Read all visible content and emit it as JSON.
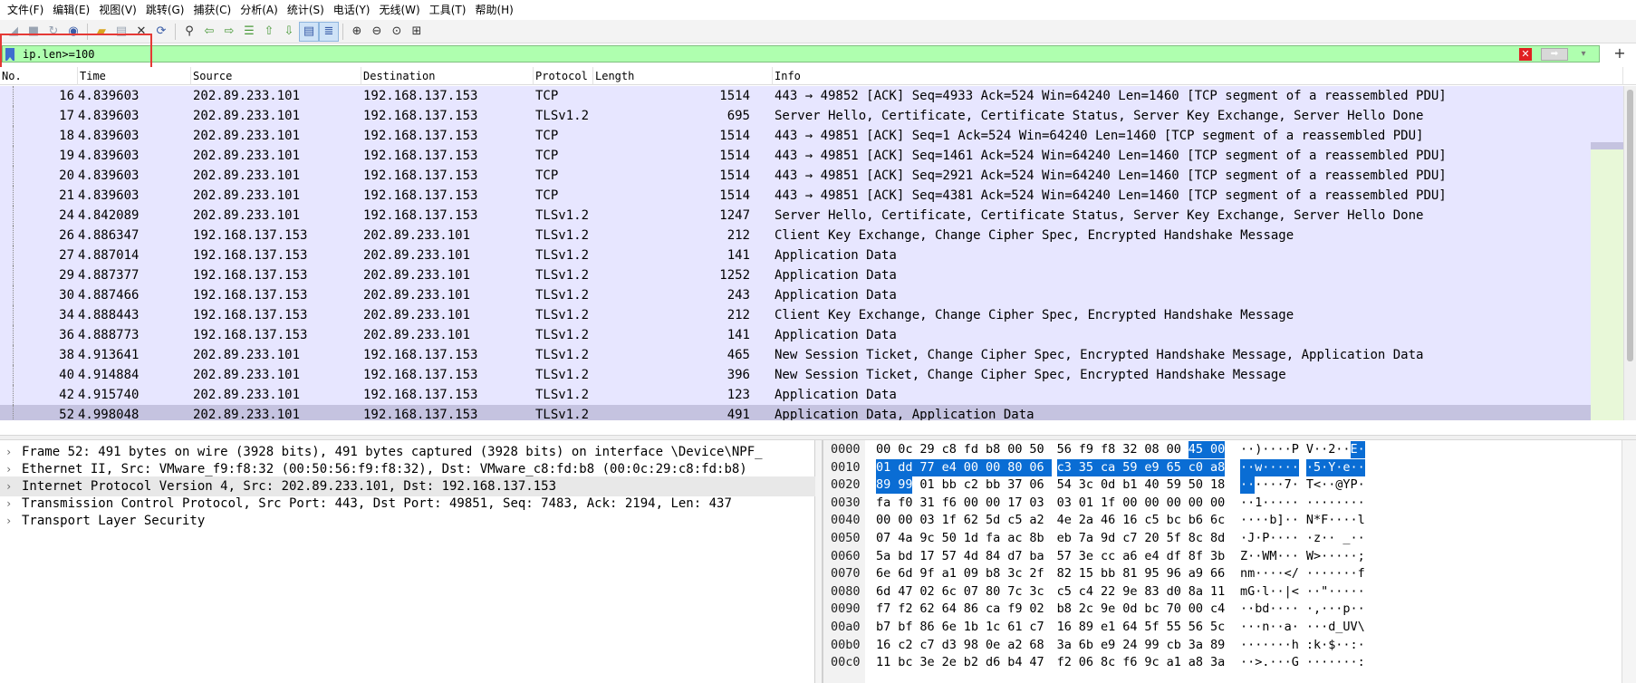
{
  "menu": [
    "文件(F)",
    "编辑(E)",
    "视图(V)",
    "跳转(G)",
    "捕获(C)",
    "分析(A)",
    "统计(S)",
    "电话(Y)",
    "无线(W)",
    "工具(T)",
    "帮助(H)"
  ],
  "filter": {
    "value": "ip.len>=100",
    "clear_label": "✕",
    "apply_label": "➡",
    "add_label": "+"
  },
  "columns": [
    "No.",
    "Time",
    "Source",
    "Destination",
    "Protocol",
    "Length",
    "Info"
  ],
  "packets": [
    {
      "no": "16",
      "time": "4.839603",
      "src": "202.89.233.101",
      "dst": "192.168.137.153",
      "proto": "TCP",
      "len": "1514",
      "info": "443 → 49852 [ACK] Seq=4933 Ack=524 Win=64240 Len=1460 [TCP segment of a reassembled PDU]"
    },
    {
      "no": "17",
      "time": "4.839603",
      "src": "202.89.233.101",
      "dst": "192.168.137.153",
      "proto": "TLSv1.2",
      "len": "695",
      "info": "Server Hello, Certificate, Certificate Status, Server Key Exchange, Server Hello Done"
    },
    {
      "no": "18",
      "time": "4.839603",
      "src": "202.89.233.101",
      "dst": "192.168.137.153",
      "proto": "TCP",
      "len": "1514",
      "info": "443 → 49851 [ACK] Seq=1 Ack=524 Win=64240 Len=1460 [TCP segment of a reassembled PDU]"
    },
    {
      "no": "19",
      "time": "4.839603",
      "src": "202.89.233.101",
      "dst": "192.168.137.153",
      "proto": "TCP",
      "len": "1514",
      "info": "443 → 49851 [ACK] Seq=1461 Ack=524 Win=64240 Len=1460 [TCP segment of a reassembled PDU]"
    },
    {
      "no": "20",
      "time": "4.839603",
      "src": "202.89.233.101",
      "dst": "192.168.137.153",
      "proto": "TCP",
      "len": "1514",
      "info": "443 → 49851 [ACK] Seq=2921 Ack=524 Win=64240 Len=1460 [TCP segment of a reassembled PDU]"
    },
    {
      "no": "21",
      "time": "4.839603",
      "src": "202.89.233.101",
      "dst": "192.168.137.153",
      "proto": "TCP",
      "len": "1514",
      "info": "443 → 49851 [ACK] Seq=4381 Ack=524 Win=64240 Len=1460 [TCP segment of a reassembled PDU]"
    },
    {
      "no": "24",
      "time": "4.842089",
      "src": "202.89.233.101",
      "dst": "192.168.137.153",
      "proto": "TLSv1.2",
      "len": "1247",
      "info": "Server Hello, Certificate, Certificate Status, Server Key Exchange, Server Hello Done"
    },
    {
      "no": "26",
      "time": "4.886347",
      "src": "192.168.137.153",
      "dst": "202.89.233.101",
      "proto": "TLSv1.2",
      "len": "212",
      "info": "Client Key Exchange, Change Cipher Spec, Encrypted Handshake Message"
    },
    {
      "no": "27",
      "time": "4.887014",
      "src": "192.168.137.153",
      "dst": "202.89.233.101",
      "proto": "TLSv1.2",
      "len": "141",
      "info": "Application Data"
    },
    {
      "no": "29",
      "time": "4.887377",
      "src": "192.168.137.153",
      "dst": "202.89.233.101",
      "proto": "TLSv1.2",
      "len": "1252",
      "info": "Application Data"
    },
    {
      "no": "30",
      "time": "4.887466",
      "src": "192.168.137.153",
      "dst": "202.89.233.101",
      "proto": "TLSv1.2",
      "len": "243",
      "info": "Application Data"
    },
    {
      "no": "34",
      "time": "4.888443",
      "src": "192.168.137.153",
      "dst": "202.89.233.101",
      "proto": "TLSv1.2",
      "len": "212",
      "info": "Client Key Exchange, Change Cipher Spec, Encrypted Handshake Message"
    },
    {
      "no": "36",
      "time": "4.888773",
      "src": "192.168.137.153",
      "dst": "202.89.233.101",
      "proto": "TLSv1.2",
      "len": "141",
      "info": "Application Data"
    },
    {
      "no": "38",
      "time": "4.913641",
      "src": "202.89.233.101",
      "dst": "192.168.137.153",
      "proto": "TLSv1.2",
      "len": "465",
      "info": "New Session Ticket, Change Cipher Spec, Encrypted Handshake Message, Application Data"
    },
    {
      "no": "40",
      "time": "4.914884",
      "src": "202.89.233.101",
      "dst": "192.168.137.153",
      "proto": "TLSv1.2",
      "len": "396",
      "info": "New Session Ticket, Change Cipher Spec, Encrypted Handshake Message"
    },
    {
      "no": "42",
      "time": "4.915740",
      "src": "202.89.233.101",
      "dst": "192.168.137.153",
      "proto": "TLSv1.2",
      "len": "123",
      "info": "Application Data"
    },
    {
      "no": "52",
      "time": "4.998048",
      "src": "202.89.233.101",
      "dst": "192.168.137.153",
      "proto": "TLSv1.2",
      "len": "491",
      "info": "Application Data, Application Data"
    }
  ],
  "selected_packet": "52",
  "details": [
    "Frame 52: 491 bytes on wire (3928 bits), 491 bytes captured (3928 bits) on interface \\Device\\NPF_",
    "Ethernet II, Src: VMware_f9:f8:32 (00:50:56:f9:f8:32), Dst: VMware_c8:fd:b8 (00:0c:29:c8:fd:b8)",
    "Internet Protocol Version 4, Src: 202.89.233.101, Dst: 192.168.137.153",
    "Transmission Control Protocol, Src Port: 443, Dst Port: 49851, Seq: 7483, Ack: 2194, Len: 437",
    "Transport Layer Security"
  ],
  "selected_detail_index": 2,
  "bytes": [
    {
      "off": "0000",
      "hex": [
        "00",
        "0c",
        "29",
        "c8",
        "fd",
        "b8",
        "00",
        "50",
        "56",
        "f9",
        "f8",
        "32",
        "08",
        "00",
        "45",
        "00"
      ],
      "ascii": "··)····P V··2··E·"
    },
    {
      "off": "0010",
      "hex": [
        "01",
        "dd",
        "77",
        "e4",
        "00",
        "00",
        "80",
        "06",
        "c3",
        "35",
        "ca",
        "59",
        "e9",
        "65",
        "c0",
        "a8"
      ],
      "ascii": "··w····· ·5·Y·e··"
    },
    {
      "off": "0020",
      "hex": [
        "89",
        "99",
        "01",
        "bb",
        "c2",
        "bb",
        "37",
        "06",
        "54",
        "3c",
        "0d",
        "b1",
        "40",
        "59",
        "50",
        "18"
      ],
      "ascii": "······7· T<··@YP·"
    },
    {
      "off": "0030",
      "hex": [
        "fa",
        "f0",
        "31",
        "f6",
        "00",
        "00",
        "17",
        "03",
        "03",
        "01",
        "1f",
        "00",
        "00",
        "00",
        "00",
        "00"
      ],
      "ascii": "··1····· ········"
    },
    {
      "off": "0040",
      "hex": [
        "00",
        "00",
        "03",
        "1f",
        "62",
        "5d",
        "c5",
        "a2",
        "4e",
        "2a",
        "46",
        "16",
        "c5",
        "bc",
        "b6",
        "6c"
      ],
      "ascii": "····b]·· N*F····l"
    },
    {
      "off": "0050",
      "hex": [
        "07",
        "4a",
        "9c",
        "50",
        "1d",
        "fa",
        "ac",
        "8b",
        "eb",
        "7a",
        "9d",
        "c7",
        "20",
        "5f",
        "8c",
        "8d"
      ],
      "ascii": "·J·P···· ·z·· _··"
    },
    {
      "off": "0060",
      "hex": [
        "5a",
        "bd",
        "17",
        "57",
        "4d",
        "84",
        "d7",
        "ba",
        "57",
        "3e",
        "cc",
        "a6",
        "e4",
        "df",
        "8f",
        "3b"
      ],
      "ascii": "Z··WM··· W>·····;"
    },
    {
      "off": "0070",
      "hex": [
        "6e",
        "6d",
        "9f",
        "a1",
        "09",
        "b8",
        "3c",
        "2f",
        "82",
        "15",
        "bb",
        "81",
        "95",
        "96",
        "a9",
        "66"
      ],
      "ascii": "nm····</ ·······f"
    },
    {
      "off": "0080",
      "hex": [
        "6d",
        "47",
        "02",
        "6c",
        "07",
        "80",
        "7c",
        "3c",
        "c5",
        "c4",
        "22",
        "9e",
        "83",
        "d0",
        "8a",
        "11"
      ],
      "ascii": "mG·l··|< ··\"·····"
    },
    {
      "off": "0090",
      "hex": [
        "f7",
        "f2",
        "62",
        "64",
        "86",
        "ca",
        "f9",
        "02",
        "b8",
        "2c",
        "9e",
        "0d",
        "bc",
        "70",
        "00",
        "c4"
      ],
      "ascii": "··bd···· ·,···p··"
    },
    {
      "off": "00a0",
      "hex": [
        "b7",
        "bf",
        "86",
        "6e",
        "1b",
        "1c",
        "61",
        "c7",
        "16",
        "89",
        "e1",
        "64",
        "5f",
        "55",
        "56",
        "5c"
      ],
      "ascii": "···n··a· ···d_UV\\"
    },
    {
      "off": "00b0",
      "hex": [
        "16",
        "c2",
        "c7",
        "d3",
        "98",
        "0e",
        "a2",
        "68",
        "3a",
        "6b",
        "e9",
        "24",
        "99",
        "cb",
        "3a",
        "89"
      ],
      "ascii": "·······h :k·$··:·"
    },
    {
      "off": "00c0",
      "hex": [
        "11",
        "bc",
        "3e",
        "2e",
        "b2",
        "d6",
        "b4",
        "47",
        "f2",
        "06",
        "8c",
        "f6",
        "9c",
        "a1",
        "a8",
        "3a"
      ],
      "ascii": "··>.···G ·······:"
    }
  ],
  "highlight": {
    "start": 14,
    "end": 33,
    "color": "#0a6dd4"
  },
  "colors": {
    "row_bg": "#e7e6ff",
    "row_selected": "#c5c3e0",
    "filter_ok": "#afffaf",
    "annotation_box": "#e53935"
  }
}
